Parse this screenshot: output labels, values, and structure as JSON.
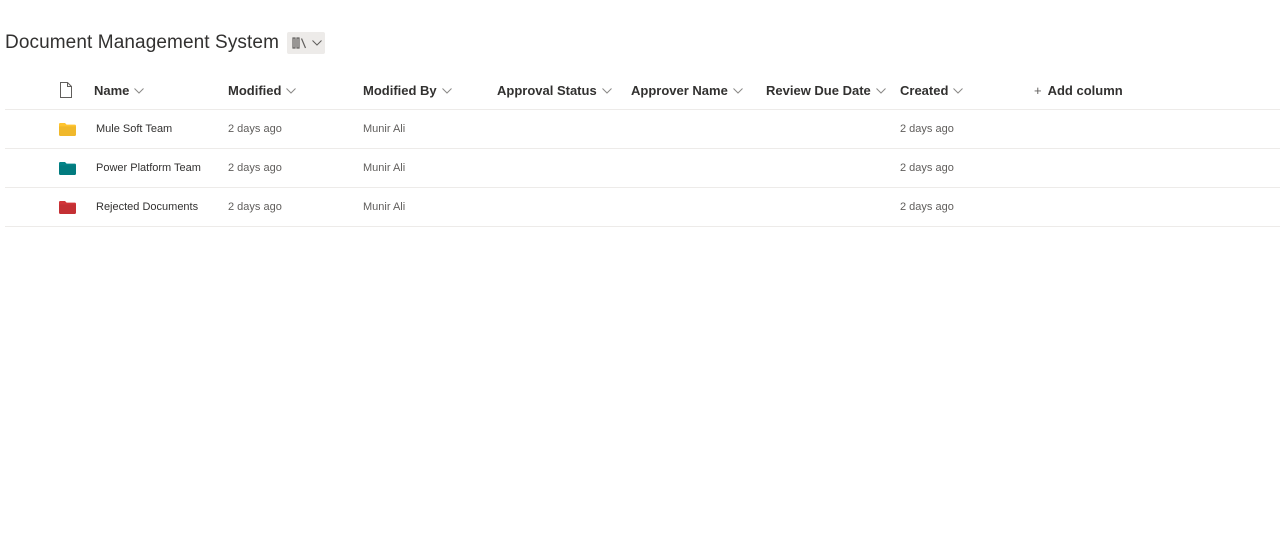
{
  "library": {
    "title": "Document Management System",
    "view_icon": "library-icon"
  },
  "columns": {
    "file_type_icon": "document-icon",
    "name": "Name",
    "modified": "Modified",
    "modified_by": "Modified By",
    "approval_status": "Approval Status",
    "approver_name": "Approver Name",
    "review_due_date": "Review Due Date",
    "created": "Created",
    "add_column": "Add column",
    "add_column_icon": "plus-icon"
  },
  "rows": [
    {
      "name": "Mule Soft Team",
      "modified": "2 days ago",
      "modified_by": "Munir Ali",
      "approval_status": "",
      "approver_name": "",
      "review_due_date": "",
      "created": "2 days ago",
      "icon": "folder-icon",
      "color": "#FFC42E"
    },
    {
      "name": "Power Platform Team",
      "modified": "2 days ago",
      "modified_by": "Munir Ali",
      "approval_status": "",
      "approver_name": "",
      "review_due_date": "",
      "created": "2 days ago",
      "icon": "folder-icon",
      "color": "#038387"
    },
    {
      "name": "Rejected Documents",
      "modified": "2 days ago",
      "modified_by": "Munir Ali",
      "approval_status": "",
      "approver_name": "",
      "review_due_date": "",
      "created": "2 days ago",
      "icon": "folder-icon",
      "color": "#D13438"
    }
  ]
}
